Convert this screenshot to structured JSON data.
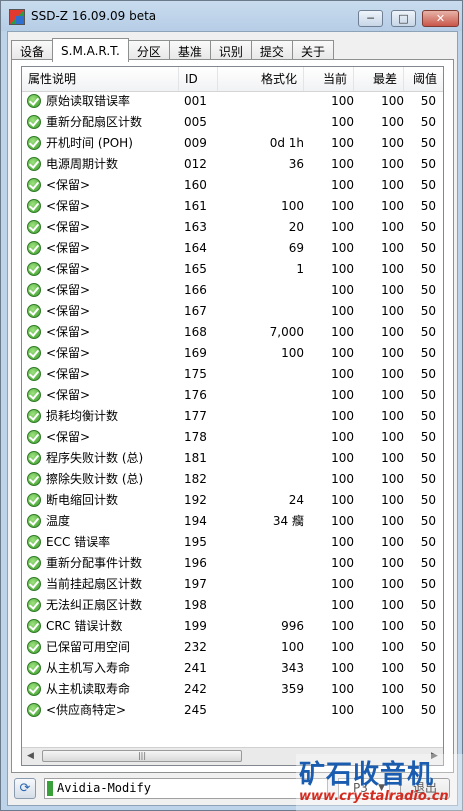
{
  "window": {
    "title": "SSD-Z 16.09.09 beta",
    "minimize_icon": "minimize-icon",
    "maximize_icon": "maximize-icon",
    "close_icon": "close-icon"
  },
  "tabs": [
    {
      "label": "设备",
      "active": false
    },
    {
      "label": "S.M.A.R.T.",
      "active": true
    },
    {
      "label": "分区",
      "active": false
    },
    {
      "label": "基准",
      "active": false
    },
    {
      "label": "识别",
      "active": false
    },
    {
      "label": "提交",
      "active": false
    },
    {
      "label": "关于",
      "active": false
    }
  ],
  "smart_table": {
    "columns": {
      "name": "属性说明",
      "id": "ID",
      "format": "格式化",
      "current": "当前",
      "worst": "最差",
      "threshold": "阈值"
    },
    "status_icon": "ok-check-icon",
    "rows": [
      {
        "name": "原始读取错误率",
        "id": "001",
        "format": "",
        "current": "100",
        "worst": "100",
        "threshold": "50"
      },
      {
        "name": "重新分配扇区计数",
        "id": "005",
        "format": "",
        "current": "100",
        "worst": "100",
        "threshold": "50"
      },
      {
        "name": "开机时间 (POH)",
        "id": "009",
        "format": "0d 1h",
        "current": "100",
        "worst": "100",
        "threshold": "50"
      },
      {
        "name": "电源周期计数",
        "id": "012",
        "format": "36",
        "current": "100",
        "worst": "100",
        "threshold": "50"
      },
      {
        "name": "<保留>",
        "id": "160",
        "format": "",
        "current": "100",
        "worst": "100",
        "threshold": "50"
      },
      {
        "name": "<保留>",
        "id": "161",
        "format": "100",
        "current": "100",
        "worst": "100",
        "threshold": "50"
      },
      {
        "name": "<保留>",
        "id": "163",
        "format": "20",
        "current": "100",
        "worst": "100",
        "threshold": "50"
      },
      {
        "name": "<保留>",
        "id": "164",
        "format": "69",
        "current": "100",
        "worst": "100",
        "threshold": "50"
      },
      {
        "name": "<保留>",
        "id": "165",
        "format": "1",
        "current": "100",
        "worst": "100",
        "threshold": "50"
      },
      {
        "name": "<保留>",
        "id": "166",
        "format": "",
        "current": "100",
        "worst": "100",
        "threshold": "50"
      },
      {
        "name": "<保留>",
        "id": "167",
        "format": "",
        "current": "100",
        "worst": "100",
        "threshold": "50"
      },
      {
        "name": "<保留>",
        "id": "168",
        "format": "7,000",
        "current": "100",
        "worst": "100",
        "threshold": "50"
      },
      {
        "name": "<保留>",
        "id": "169",
        "format": "100",
        "current": "100",
        "worst": "100",
        "threshold": "50"
      },
      {
        "name": "<保留>",
        "id": "175",
        "format": "",
        "current": "100",
        "worst": "100",
        "threshold": "50"
      },
      {
        "name": "<保留>",
        "id": "176",
        "format": "",
        "current": "100",
        "worst": "100",
        "threshold": "50"
      },
      {
        "name": "损耗均衡计数",
        "id": "177",
        "format": "",
        "current": "100",
        "worst": "100",
        "threshold": "50"
      },
      {
        "name": "<保留>",
        "id": "178",
        "format": "",
        "current": "100",
        "worst": "100",
        "threshold": "50"
      },
      {
        "name": "程序失败计数 (总)",
        "id": "181",
        "format": "",
        "current": "100",
        "worst": "100",
        "threshold": "50"
      },
      {
        "name": "擦除失败计数 (总)",
        "id": "182",
        "format": "",
        "current": "100",
        "worst": "100",
        "threshold": "50"
      },
      {
        "name": "断电缩回计数",
        "id": "192",
        "format": "24",
        "current": "100",
        "worst": "100",
        "threshold": "50"
      },
      {
        "name": "温度",
        "id": "194",
        "format": "34 癵",
        "current": "100",
        "worst": "100",
        "threshold": "50"
      },
      {
        "name": "ECC 错误率",
        "id": "195",
        "format": "",
        "current": "100",
        "worst": "100",
        "threshold": "50"
      },
      {
        "name": "重新分配事件计数",
        "id": "196",
        "format": "",
        "current": "100",
        "worst": "100",
        "threshold": "50"
      },
      {
        "name": "当前挂起扇区计数",
        "id": "197",
        "format": "",
        "current": "100",
        "worst": "100",
        "threshold": "50"
      },
      {
        "name": "无法纠正扇区计数",
        "id": "198",
        "format": "",
        "current": "100",
        "worst": "100",
        "threshold": "50"
      },
      {
        "name": "CRC 错误计数",
        "id": "199",
        "format": "996",
        "current": "100",
        "worst": "100",
        "threshold": "50"
      },
      {
        "name": "已保留可用空间",
        "id": "232",
        "format": "100",
        "current": "100",
        "worst": "100",
        "threshold": "50"
      },
      {
        "name": "从主机写入寿命",
        "id": "241",
        "format": "343",
        "current": "100",
        "worst": "100",
        "threshold": "50"
      },
      {
        "name": "从主机读取寿命",
        "id": "242",
        "format": "359",
        "current": "100",
        "worst": "100",
        "threshold": "50"
      },
      {
        "name": "<供应商特定>",
        "id": "245",
        "format": "",
        "current": "100",
        "worst": "100",
        "threshold": "50"
      }
    ]
  },
  "statusbar": {
    "refresh_icon": "refresh-icon",
    "drive_name": "Avidia-Modify",
    "page": "P3",
    "exit_label": "退出"
  },
  "watermark": {
    "text": "矿石收音机",
    "url": "www.crystalradio.cn"
  }
}
